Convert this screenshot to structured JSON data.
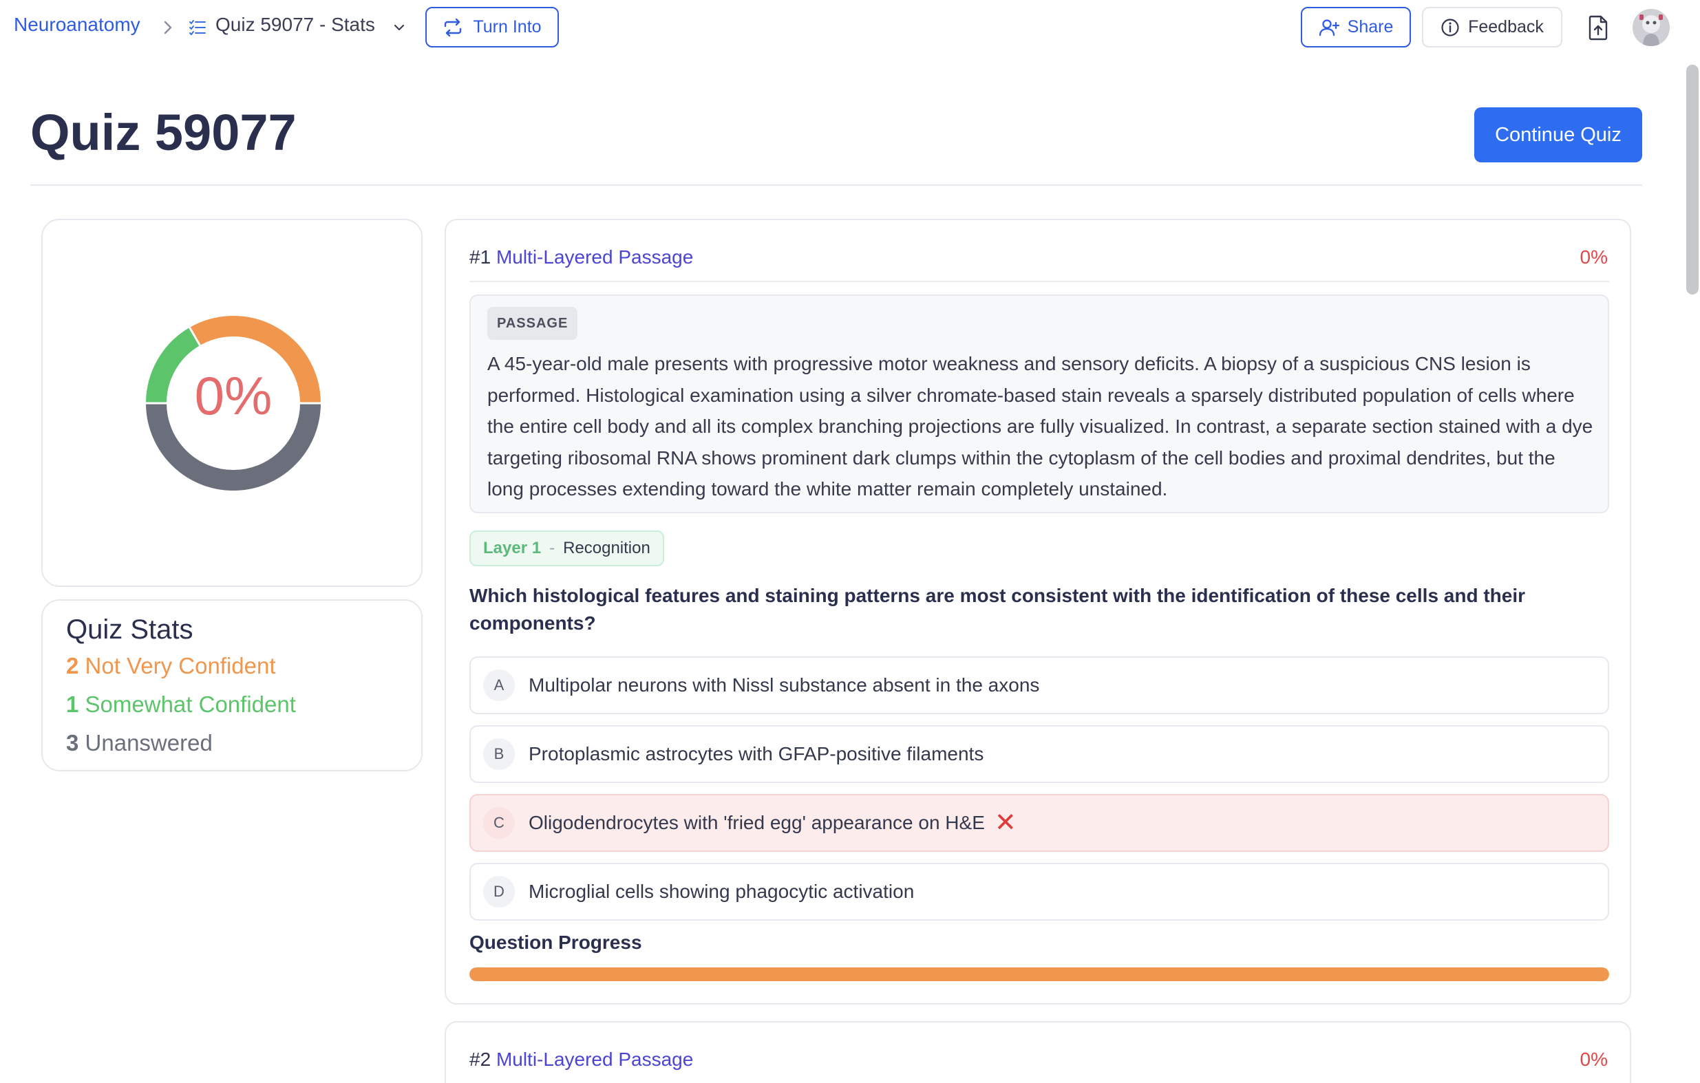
{
  "breadcrumb": {
    "root": "Neuroanatomy",
    "current": "Quiz 59077 - Stats"
  },
  "toolbar": {
    "turn_into": "Turn Into",
    "share": "Share",
    "feedback": "Feedback"
  },
  "header": {
    "title": "Quiz 59077",
    "continue": "Continue Quiz"
  },
  "score": {
    "label": "0%",
    "segments": [
      {
        "name": "Not Very Confident",
        "count": 2,
        "color": "#f0964d"
      },
      {
        "name": "Somewhat Confident",
        "count": 1,
        "color": "#5cc46a"
      },
      {
        "name": "Unanswered",
        "count": 3,
        "color": "#6b6f7b"
      }
    ]
  },
  "stats": {
    "title": "Quiz Stats",
    "items": [
      {
        "count": "2",
        "label": "Not Very Confident",
        "color": "#f0964d"
      },
      {
        "count": "1",
        "label": "Somewhat Confident",
        "color": "#5cc46a"
      },
      {
        "count": "3",
        "label": "Unanswered",
        "color": "#6b6f7b"
      }
    ]
  },
  "questions": [
    {
      "number": "#1",
      "type": "Multi-Layered Passage",
      "percent": "0%",
      "passage_tag": "PASSAGE",
      "passage": "A 45-year-old male presents with progressive motor weakness and sensory deficits. A biopsy of a suspicious CNS lesion is performed. Histological examination using a silver chromate-based stain reveals a sparsely distributed population of cells where the entire cell body and all its complex branching projections are fully visualized. In contrast, a separate section stained with a dye targeting ribosomal RNA shows prominent dark clumps within the cytoplasm of the cell bodies and proximal dendrites, but the long processes extending toward the white matter remain completely unstained.",
      "layer": "Layer 1",
      "layer_sep": "-",
      "layer_type": "Recognition",
      "question": "Which histological features and staining patterns are most consistent with the identification of these cells and their components?",
      "options": [
        {
          "letter": "A",
          "text": "Multipolar neurons with Nissl substance absent in the axons",
          "state": "default"
        },
        {
          "letter": "B",
          "text": "Protoplasmic astrocytes with GFAP-positive filaments",
          "state": "default"
        },
        {
          "letter": "C",
          "text": "Oligodendrocytes with 'fried egg' appearance on H&E",
          "state": "wrong",
          "mark": "✕"
        },
        {
          "letter": "D",
          "text": "Microglial cells showing phagocytic activation",
          "state": "default"
        }
      ],
      "progress_label": "Question Progress",
      "progress_fraction": 1.0,
      "progress_color": "#f0964d"
    },
    {
      "number": "#2",
      "type": "Multi-Layered Passage",
      "percent": "0%"
    }
  ]
}
